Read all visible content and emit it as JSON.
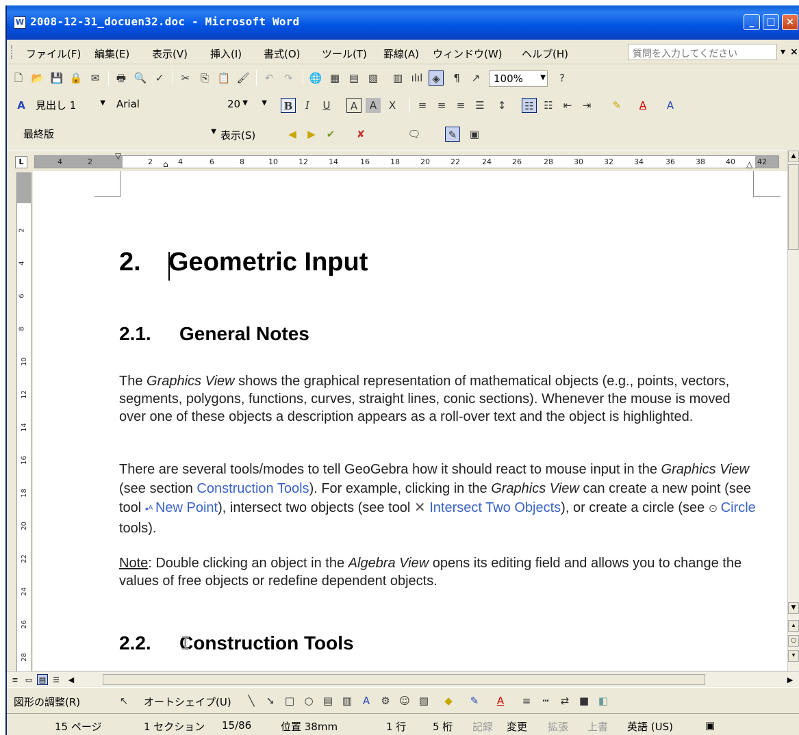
{
  "window": {
    "title": "2008-12-31_docuen32.doc - Microsoft Word"
  },
  "menu": {
    "items": [
      "ファイル(F)",
      "編集(E)",
      "表示(V)",
      "挿入(I)",
      "書式(O)",
      "ツール(T)",
      "罫線(A)",
      "ウィンドウ(W)",
      "ヘルプ(H)"
    ],
    "help_placeholder": "質問を入力してください"
  },
  "standard_toolbar": {
    "zoom": "100%"
  },
  "format_toolbar": {
    "style": "見出し 1",
    "font": "Arial",
    "size": "20"
  },
  "review_toolbar": {
    "view_mode": "最終版",
    "show_label": "表示(S)"
  },
  "ruler": {
    "ticks": [
      "4",
      "2",
      "2",
      "4",
      "6",
      "8",
      "10",
      "12",
      "14",
      "16",
      "18",
      "20",
      "22",
      "24",
      "26",
      "28",
      "30",
      "32",
      "34",
      "36",
      "38",
      "40",
      "42"
    ]
  },
  "vertical_ruler": {
    "ticks": [
      "2",
      "4",
      "6",
      "8",
      "10",
      "12",
      "14",
      "16",
      "18",
      "20",
      "22",
      "24",
      "26",
      "28"
    ]
  },
  "document": {
    "heading1": {
      "number": "2.",
      "text": "Geometric Input"
    },
    "heading2a": {
      "number": "2.1.",
      "text": "General Notes"
    },
    "para1": {
      "t1": "The ",
      "em1": "Graphics View",
      "t2": " shows the graphical representation of mathematical objects (e.g., points, vectors, segments, polygons, functions, curves, straight lines, conic sections). Whenever the mouse is moved over one of these objects a description appears as a roll-over text and the object is highlighted."
    },
    "para2": {
      "t1": "There are several tools/modes to tell GeoGebra how it should react to mouse input in the ",
      "em1": "Graphics View",
      "t2": " (see section ",
      "link1": "Construction Tools",
      "t3": "). For example, clicking in the ",
      "em2": "Graphics View",
      "t4": " can create a new point (see tool ",
      "link2": "New Point",
      "t5": "), intersect two objects (see tool ",
      "link3": "Intersect Two Objects",
      "t6": "), or create a circle (see ",
      "link4": "Circle",
      "t7": " tools)."
    },
    "para3": {
      "note": "Note",
      "t1": ": Double clicking an object in the ",
      "em1": "Algebra View",
      "t2": " opens its editing field and allows you to change the values of free objects or redefine dependent objects."
    },
    "heading2b": {
      "number": "2.2.",
      "text": "Construction Tools"
    }
  },
  "drawing_toolbar": {
    "draw_menu": "図形の調整(R)",
    "autoshape_menu": "オートシェイプ(U)"
  },
  "status": {
    "page": "15 ページ",
    "section": "1 セクション",
    "page_of": "15/86",
    "position": "位置 38mm",
    "line": "1 行",
    "column": "5 桁",
    "rec": "記録",
    "trk": "変更",
    "ext": "拡張",
    "ovr": "上書",
    "language": "英語 (US)"
  }
}
